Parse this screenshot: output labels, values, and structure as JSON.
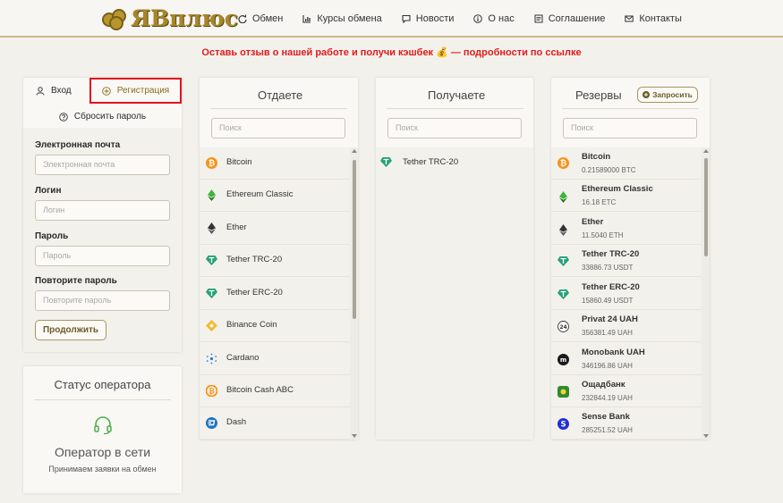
{
  "header": {
    "logo_text": "ЯВплюс",
    "nav": [
      {
        "label": "Обмен",
        "icon": "refresh-icon"
      },
      {
        "label": "Курсы обмена",
        "icon": "chart-icon"
      },
      {
        "label": "Новости",
        "icon": "news-icon"
      },
      {
        "label": "О нас",
        "icon": "info-icon"
      },
      {
        "label": "Соглашение",
        "icon": "document-icon"
      },
      {
        "label": "Контакты",
        "icon": "mail-icon"
      }
    ]
  },
  "banner": "Оставь отзыв о нашей работе и получи кэшбек 💰 — подробности по ссылке",
  "auth": {
    "login_tab": "Вход",
    "register_tab": "Регистрация",
    "reset_password": "Сбросить пароль",
    "fields": [
      {
        "label": "Электронная почта",
        "placeholder": "Электронная почта"
      },
      {
        "label": "Логин",
        "placeholder": "Логин"
      },
      {
        "label": "Пароль",
        "placeholder": "Пароль"
      },
      {
        "label": "Повторите пароль",
        "placeholder": "Повторите пароль"
      }
    ],
    "continue": "Продолжить"
  },
  "operator": {
    "title": "Статус оператора",
    "status": "Оператор в сети",
    "subtitle": "Принимаем заявки на обмен"
  },
  "give": {
    "title": "Отдаете",
    "search_placeholder": "Поиск",
    "items": [
      {
        "name": "Bitcoin",
        "icon": "bitcoin-icon"
      },
      {
        "name": "Ethereum Classic",
        "icon": "ethereum-classic-icon"
      },
      {
        "name": "Ether",
        "icon": "ether-icon"
      },
      {
        "name": "Tether TRC-20",
        "icon": "tether-icon"
      },
      {
        "name": "Tether ERC-20",
        "icon": "tether-icon"
      },
      {
        "name": "Binance Coin",
        "icon": "binance-icon"
      },
      {
        "name": "Cardano",
        "icon": "cardano-icon"
      },
      {
        "name": "Bitcoin Cash ABC",
        "icon": "bitcoin-cash-icon"
      },
      {
        "name": "Dash",
        "icon": "dash-icon"
      }
    ]
  },
  "get": {
    "title": "Получаете",
    "search_placeholder": "Поиск",
    "items": [
      {
        "name": "Tether TRC-20",
        "icon": "tether-icon"
      }
    ]
  },
  "reserves": {
    "title": "Резервы",
    "request_button": "Запросить",
    "search_placeholder": "Поиск",
    "items": [
      {
        "name": "Bitcoin",
        "amount": "0.21589000 BTC",
        "icon": "bitcoin-icon"
      },
      {
        "name": "Ethereum Classic",
        "amount": "16.18 ETC",
        "icon": "ethereum-classic-icon"
      },
      {
        "name": "Ether",
        "amount": "11.5040 ETH",
        "icon": "ether-icon"
      },
      {
        "name": "Tether TRC-20",
        "amount": "33886.73 USDT",
        "icon": "tether-icon"
      },
      {
        "name": "Tether ERC-20",
        "amount": "15860.49 USDT",
        "icon": "tether-icon"
      },
      {
        "name": "Privat 24 UAH",
        "amount": "356381.49 UAH",
        "icon": "privat24-icon"
      },
      {
        "name": "Monobank UAH",
        "amount": "346196.86 UAH",
        "icon": "monobank-icon"
      },
      {
        "name": "Ощадбанк",
        "amount": "232844.19 UAH",
        "icon": "oschadbank-icon"
      },
      {
        "name": "Sense Bank",
        "amount": "285251.52 UAH",
        "icon": "sense-bank-icon"
      }
    ]
  },
  "colors": {
    "accent_gold": "#a8862a",
    "highlight_red": "#e0141c",
    "bitcoin": "#f7931a",
    "tether": "#26a17b",
    "etc_green": "#3ab83a"
  }
}
